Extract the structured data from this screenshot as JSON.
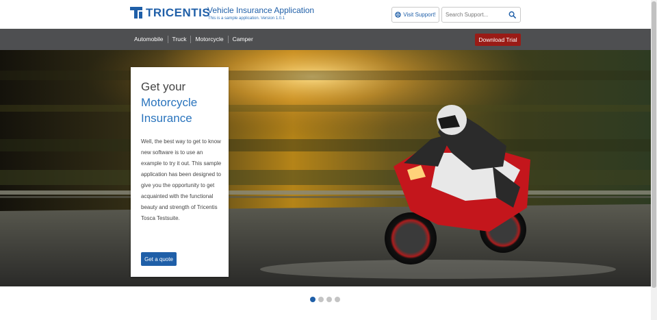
{
  "header": {
    "logo_text": "TRICENTIS",
    "app_title": "Vehicle Insurance Application",
    "app_subtitle": "This is a sample application. Version 1.0.1",
    "support_label": "Visit Support!",
    "search_placeholder": "Search Support..."
  },
  "nav": {
    "items": [
      {
        "label": "Automobile"
      },
      {
        "label": "Truck"
      },
      {
        "label": "Motorcycle"
      },
      {
        "label": "Camper"
      }
    ],
    "download_label": "Download Trial"
  },
  "hero": {
    "heading_line1": "Get your",
    "heading_line2": "Motorcycle",
    "heading_line3": "Insurance",
    "body": "Well, the best way to get to know new software is to use an example to try it out. This sample application has been designed to give you the opportunity to get acquainted with the functional beauty and strength of Tricentis Tosca Testsuite.",
    "cta_label": "Get a quote"
  },
  "carousel": {
    "count": 4,
    "active_index": 0
  },
  "colors": {
    "brand_blue": "#1f5fa8",
    "nav_bg": "#4e4f51",
    "download_red": "#9a1b16"
  }
}
